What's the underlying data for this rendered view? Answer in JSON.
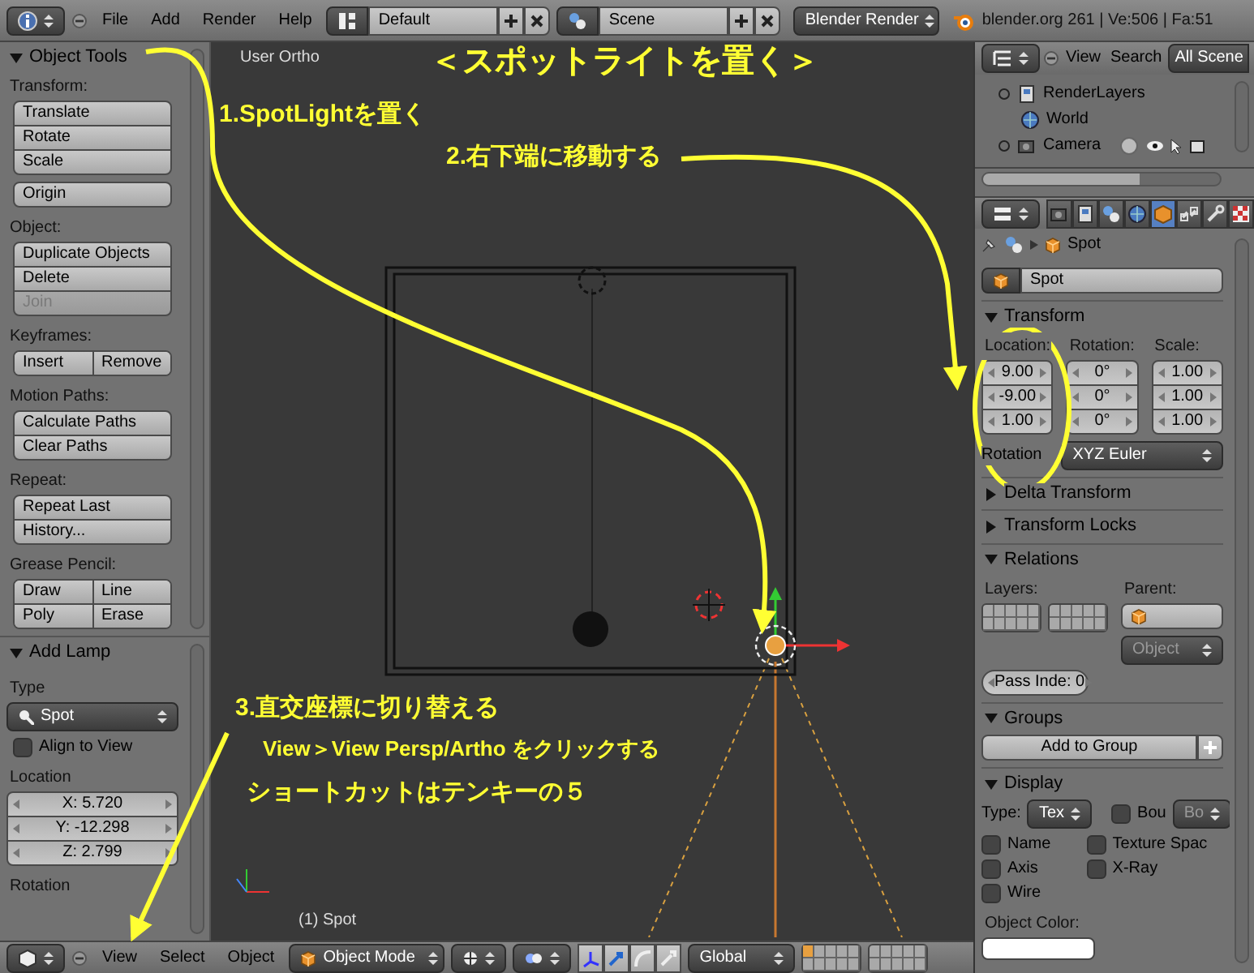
{
  "top_bar": {
    "menus": [
      "File",
      "Add",
      "Render",
      "Help"
    ],
    "layout": "Default",
    "scene": "Scene",
    "engine": "Blender Render",
    "stats": "blender.org 261 | Ve:506 | Fa:51"
  },
  "tool_shelf": {
    "panels": [
      {
        "title": "Object Tools",
        "expanded": true,
        "groups": [
          {
            "label": "Transform:",
            "rows": [
              [
                {
                  "label": "Translate",
                  "disabled": false
                }
              ],
              [
                {
                  "label": "Rotate",
                  "disabled": false
                }
              ],
              [
                {
                  "label": "Scale",
                  "disabled": false
                }
              ]
            ]
          },
          {
            "rows": [
              [
                {
                  "label": "Origin",
                  "disabled": false
                }
              ]
            ]
          },
          {
            "label": "Object:",
            "rows": [
              [
                {
                  "label": "Duplicate Objects",
                  "disabled": false
                }
              ],
              [
                {
                  "label": "Delete",
                  "disabled": false
                }
              ],
              [
                {
                  "label": "Join",
                  "disabled": true
                }
              ]
            ]
          },
          {
            "label": "Keyframes:",
            "rows": [
              [
                {
                  "label": "Insert",
                  "disabled": false
                },
                {
                  "label": "Remove",
                  "disabled": false
                }
              ]
            ]
          },
          {
            "label": "Motion Paths:",
            "rows": [
              [
                {
                  "label": "Calculate Paths",
                  "disabled": false
                }
              ],
              [
                {
                  "label": "Clear Paths",
                  "disabled": false
                }
              ]
            ]
          },
          {
            "label": "Repeat:",
            "rows": [
              [
                {
                  "label": "Repeat Last",
                  "disabled": false
                }
              ],
              [
                {
                  "label": "History...",
                  "disabled": false
                }
              ]
            ]
          },
          {
            "label": "Grease Pencil:",
            "rows": [
              [
                {
                  "label": "Draw",
                  "disabled": false
                },
                {
                  "label": "Line",
                  "disabled": false
                }
              ],
              [
                {
                  "label": "Poly",
                  "disabled": false
                },
                {
                  "label": "Erase",
                  "disabled": false
                }
              ]
            ]
          }
        ]
      },
      {
        "title": "Add Lamp",
        "expanded": true,
        "fields": [
          {
            "kind": "label",
            "text": "Type"
          },
          {
            "kind": "dropdown",
            "value": "Spot"
          },
          {
            "kind": "checkbox",
            "label": "Align to View",
            "checked": false
          },
          {
            "kind": "label",
            "text": "Location"
          },
          {
            "kind": "number",
            "value": "X: 5.720"
          },
          {
            "kind": "number",
            "value": "Y: -12.298"
          },
          {
            "kind": "number",
            "value": "Z: 2.799"
          },
          {
            "kind": "label",
            "text": "Rotation"
          }
        ]
      }
    ]
  },
  "viewport": {
    "view_label": "User Ortho",
    "object_label": "(1) Spot",
    "annotations": {
      "title": "＜スポットライトを置く＞",
      "step_1": "1.SpotLightを置く",
      "step_2": "2.右下端に移動する",
      "step_3": "3.直交座標に切り替える",
      "step_3_detail": "View＞View Persp/Artho をクリックする",
      "step_3_note": "ショートカットはテンキーの５"
    }
  },
  "view_header": {
    "menus": [
      "View",
      "Select",
      "Object"
    ],
    "mode": "Object Mode",
    "orientation": "Global"
  },
  "outliner": {
    "menus": [
      "View",
      "Search"
    ],
    "display_mode": "All Scene",
    "items": [
      {
        "label": "RenderLayers",
        "kind": "layers",
        "show_restrict": false
      },
      {
        "label": "World",
        "kind": "world",
        "show_restrict": false
      },
      {
        "label": "Camera",
        "kind": "camera",
        "show_restrict": true
      }
    ]
  },
  "properties": {
    "tabs": [
      {
        "kind": "camera",
        "selected": false
      },
      {
        "kind": "layers",
        "selected": false
      },
      {
        "kind": "scene",
        "selected": false
      },
      {
        "kind": "world",
        "selected": false
      },
      {
        "kind": "object",
        "selected": true
      },
      {
        "kind": "constraints",
        "selected": false
      },
      {
        "kind": "modifiers",
        "selected": false
      },
      {
        "kind": "texture",
        "selected": false
      }
    ],
    "breadcrumb": "Spot",
    "object_name": "Spot",
    "panels": [
      {
        "kind": "transform",
        "title": "Transform",
        "expanded": true,
        "columns": [
          {
            "label": "Location:",
            "values": [
              "9.00",
              "-9.00",
              "1.00"
            ]
          },
          {
            "label": "Rotation:",
            "values": [
              "0°",
              "0°",
              "0°"
            ]
          },
          {
            "label": "Scale:",
            "values": [
              "1.00",
              "1.00",
              "1.00"
            ]
          }
        ],
        "rotation_label": "Rotation",
        "rotation_mode": "XYZ Euler"
      },
      {
        "title": "Delta Transform",
        "expanded": false
      },
      {
        "title": "Transform Locks",
        "expanded": false
      },
      {
        "kind": "relations",
        "title": "Relations",
        "expanded": true,
        "layers_label": "Layers:",
        "parent_label": "Parent:",
        "parent_type": "Object",
        "pass_index": "Pass Inde: 0"
      },
      {
        "kind": "groups",
        "title": "Groups",
        "expanded": true,
        "button": "Add to Group"
      },
      {
        "kind": "display",
        "title": "Display",
        "expanded": true,
        "type_label": "Type:",
        "type": "Tex",
        "bounds_label": "Bou",
        "bounds_type": "Bo",
        "bounds_checked": false,
        "checkboxes": [
          {
            "label": "Name",
            "checked": false
          },
          {
            "label": "Texture Spac",
            "checked": false
          },
          {
            "label": "Axis",
            "checked": false
          },
          {
            "label": "X-Ray",
            "checked": false
          },
          {
            "label": "Wire",
            "checked": false
          }
        ],
        "color_label": "Object Color:"
      }
    ]
  }
}
